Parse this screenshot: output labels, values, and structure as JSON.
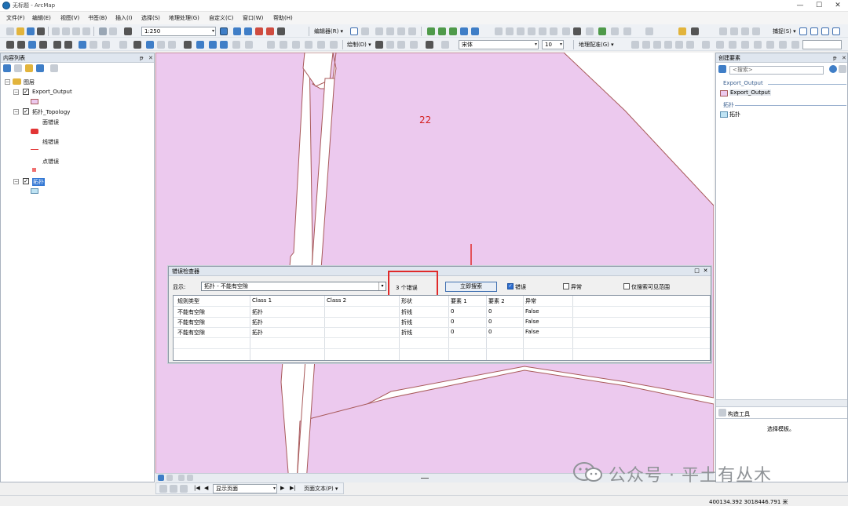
{
  "window": {
    "title": "无标题 - ArcMap"
  },
  "menu": [
    "文件(F)",
    "编辑(E)",
    "视图(V)",
    "书签(B)",
    "插入(I)",
    "选择(S)",
    "地理处理(G)",
    "自定义(C)",
    "窗口(W)",
    "帮助(H)"
  ],
  "toolbar": {
    "scale": "1:250",
    "editor_label": "编辑器(R) ▾",
    "snapping_label": "捕捉(S) ▾",
    "draw_label": "绘制(D) ▾",
    "font_name": "宋体",
    "font_size": "10",
    "georef_label": "地理配准(G) ▾"
  },
  "toc": {
    "title": "内容列表",
    "root": "图层",
    "layers": [
      {
        "name": "Export_Output"
      },
      {
        "name": "拓扑_Topology",
        "sublabels": [
          "面错误",
          "线错误",
          "点错误"
        ]
      },
      {
        "name": "拓扑"
      }
    ]
  },
  "map": {
    "label": "22"
  },
  "inspector": {
    "title": "错误检查器",
    "show_label": "显示:",
    "show_value": "拓扑 - 不能有空隙",
    "error_count": "3 个错误",
    "search_button": "立即搜索",
    "errors_label": "错误",
    "exceptions_label": "异常",
    "visible_extent_label": "仅搜索可见范围",
    "errors_checked": true,
    "exceptions_checked": false,
    "visible_extent_checked": false,
    "columns": [
      "规则类型",
      "Class 1",
      "Class 2",
      "形状",
      "要素 1",
      "要素 2",
      "异常"
    ],
    "rows": [
      [
        "不能有空隙",
        "拓扑",
        "",
        "折线",
        "0",
        "0",
        "False"
      ],
      [
        "不能有空隙",
        "拓扑",
        "",
        "折线",
        "0",
        "0",
        "False"
      ],
      [
        "不能有空隙",
        "拓扑",
        "",
        "折线",
        "0",
        "0",
        "False"
      ]
    ]
  },
  "create_features": {
    "title": "创建要素",
    "search_placeholder": "<搜索>",
    "group1": "Export_Output",
    "item1": "Export_Output",
    "group2": "拓扑",
    "item2": "拓扑",
    "construct_title": "构造工具",
    "construct_hint": "选择模板。"
  },
  "bottom": {
    "layout_combo": "显示页面",
    "page_text": "页面文本(P) ▾"
  },
  "status": {
    "coords": "400134.392  3018446.791 米"
  },
  "watermark": {
    "text": "公众号 · 平土有丛木"
  },
  "colors": {
    "polygon_fill": "#ecc9ee",
    "polygon_edge": "#a85a5a",
    "accent": "#3f7ec7",
    "error_red": "#e02a2a"
  }
}
